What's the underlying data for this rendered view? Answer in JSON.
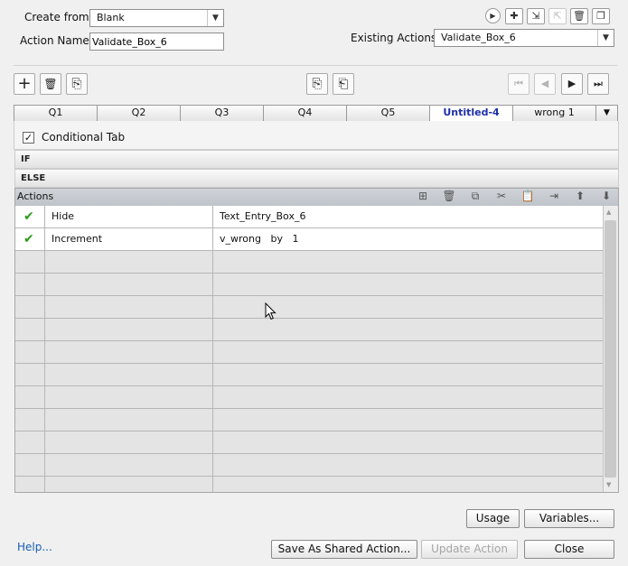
{
  "header": {
    "create_from_label": "Create from:",
    "create_from_value": "Blank",
    "action_name_label": "Action Name:",
    "action_name_value": "Validate_Box_6",
    "existing_actions_label": "Existing Actions:",
    "existing_actions_value": "Validate_Box_6",
    "top_icons": {
      "play": "▶",
      "add": "✚",
      "import": "⇲",
      "export": "⇱",
      "delete": "🗑",
      "duplicate": "❐"
    }
  },
  "toolbar": {
    "add": "+",
    "delete": "🗑",
    "duplicate": "⎘",
    "copy_tab": "⎘",
    "paste_tab": "⎗",
    "first": "⏮",
    "prev": "◀",
    "next": "▶",
    "last": "⏭"
  },
  "tabs": [
    {
      "label": "Q1"
    },
    {
      "label": "Q2"
    },
    {
      "label": "Q3"
    },
    {
      "label": "Q4"
    },
    {
      "label": "Q5"
    },
    {
      "label": "Untitled-4",
      "active": true
    },
    {
      "label": "wrong 1"
    }
  ],
  "conditional_tab": {
    "label": "Conditional Tab",
    "checked": true
  },
  "if_label": "IF",
  "else_label": "ELSE",
  "actions": {
    "header": "Actions",
    "icons": [
      "insert-row-icon",
      "delete-icon",
      "copy-icon",
      "cut-icon",
      "paste-icon",
      "insert-after-icon",
      "move-up-icon",
      "move-down-icon"
    ],
    "rows": [
      {
        "action": "Hide",
        "target": "Text_Entry_Box_6",
        "valid": true
      },
      {
        "action": "Increment",
        "target": "v_wrong   by   1",
        "valid": true
      }
    ]
  },
  "buttons": {
    "usage": "Usage",
    "variables": "Variables...",
    "help": "Help...",
    "save_shared": "Save As Shared Action...",
    "update": "Update Action",
    "close": "Close"
  },
  "colors": {
    "accent_link": "#1a5fb4",
    "active_tab": "#1d2fa8",
    "check_green": "#2d9a16"
  }
}
